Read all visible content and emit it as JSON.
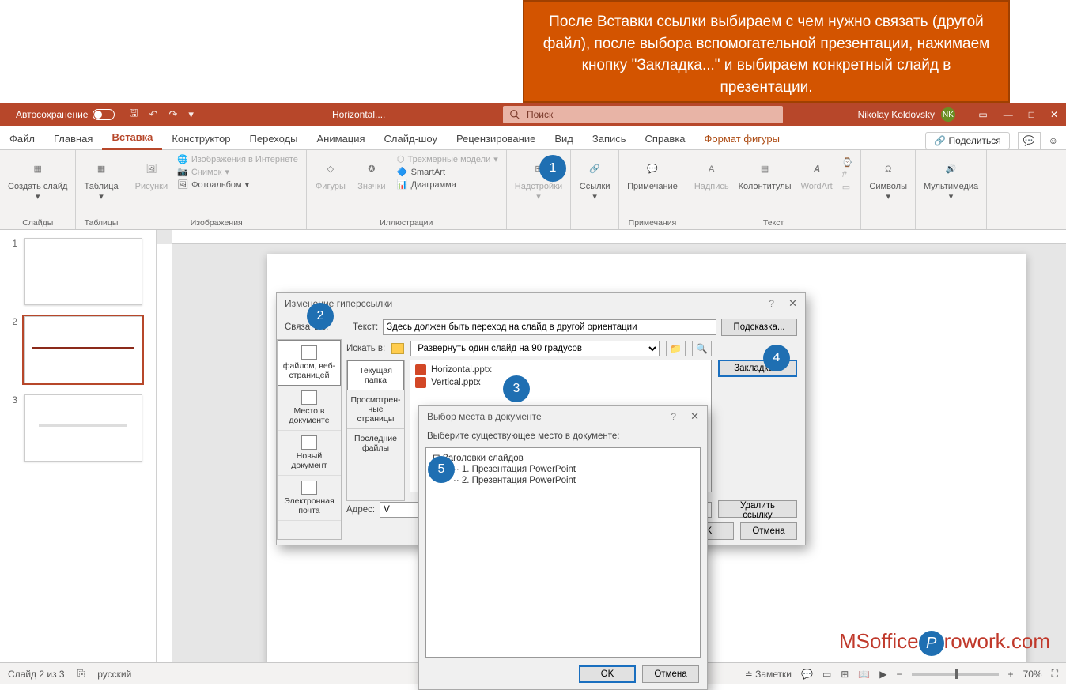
{
  "callout": "После Вставки ссылки выбираем с чем нужно связать (другой файл), после выбора вспомогательной презентации, нажимаем кнопку \"Закладка...\" и выбираем конкретный слайд в презентации.",
  "titlebar": {
    "autosave": "Автосохранение",
    "doc_title": "Horizontal....",
    "search_placeholder": "Поиск",
    "user_name": "Nikolay Koldovsky",
    "user_initials": "NK"
  },
  "tabs": {
    "items": [
      "Файл",
      "Главная",
      "Вставка",
      "Конструктор",
      "Переходы",
      "Анимация",
      "Слайд-шоу",
      "Рецензирование",
      "Вид",
      "Запись",
      "Справка",
      "Формат фигуры"
    ],
    "share": "Поделиться"
  },
  "ribbon": {
    "groups": {
      "slides": {
        "label": "Слайды",
        "new_slide": "Создать слайд"
      },
      "tables": {
        "label": "Таблицы",
        "table": "Таблица"
      },
      "images": {
        "label": "Изображения",
        "pictures": "Рисунки",
        "online": "Изображения в Интернете",
        "screenshot": "Снимок",
        "album": "Фотоальбом"
      },
      "illus": {
        "label": "Иллюстрации",
        "shapes": "Фигуры",
        "icons": "Значки",
        "models": "Трехмерные модели",
        "smartart": "SmartArt",
        "chart": "Диаграмма"
      },
      "addins": {
        "addins": "Надстройки"
      },
      "links": {
        "links": "Ссылки"
      },
      "comments": {
        "label": "Примечания",
        "comment": "Примечание"
      },
      "text": {
        "label": "Текст",
        "textbox": "Надпись",
        "headerfooter": "Колонтитулы",
        "wordart": "WordArt"
      },
      "symbols": {
        "label": "",
        "symbols": "Символы"
      },
      "media": {
        "label": "",
        "media": "Мультимедиа"
      }
    }
  },
  "thumbs": [
    "1",
    "2",
    "3"
  ],
  "dlg1": {
    "title": "Изменение гиперссылки",
    "link_to": "Связать с:",
    "text_lbl": "Текст:",
    "text_val": "Здесь должен быть переход на слайд в другой ориентации",
    "tip_btn": "Подсказка...",
    "look_in": "Искать в:",
    "folder": "Развернуть один слайд на 90 градусов",
    "side_tabs": [
      "файлом, веб-страницей",
      "Место в документе",
      "Новый документ",
      "Электронная почта"
    ],
    "inner_tabs": [
      "Текущая папка",
      "Просмотрен-ные страницы",
      "Последние файлы"
    ],
    "files": [
      "Horizontal.pptx",
      "Vertical.pptx"
    ],
    "bookmark_btn": "Закладка...",
    "address_lbl": "Адрес:",
    "address_val": "V",
    "remove_btn": "Удалить ссылку",
    "ok": "OK",
    "cancel": "Отмена"
  },
  "dlg2": {
    "title": "Выбор места в документе",
    "prompt": "Выберите существующее место в документе:",
    "tree_root": "Заголовки слайдов",
    "tree_items": [
      "1. Презентация PowerPoint",
      "2. Презентация PowerPoint"
    ],
    "ok": "OK",
    "cancel": "Отмена"
  },
  "badges": [
    "1",
    "2",
    "3",
    "4",
    "5"
  ],
  "status": {
    "slide_info": "Слайд 2 из 3",
    "lang": "русский",
    "notes": "Заметки",
    "zoom": "70%"
  },
  "watermark": {
    "ms": "MSoffice",
    "rowork": "rowork.com"
  }
}
